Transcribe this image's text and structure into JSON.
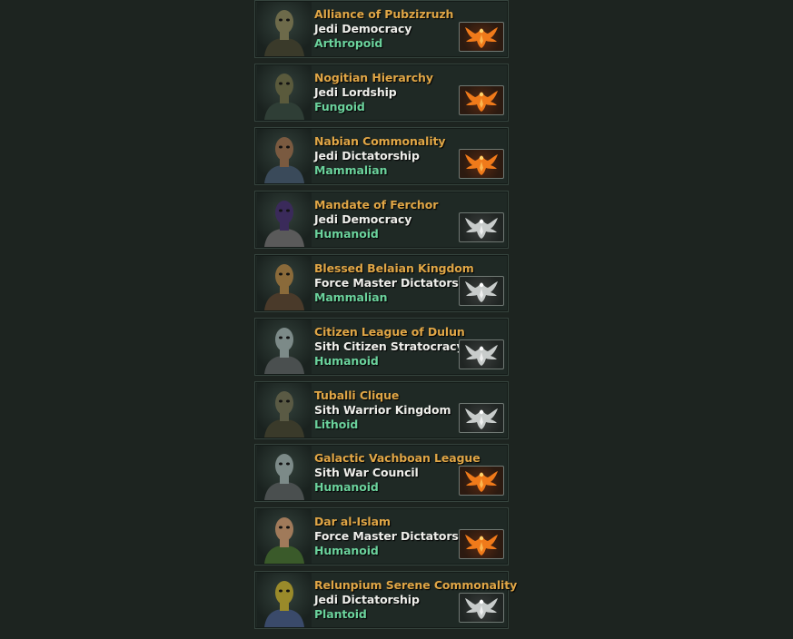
{
  "empires": [
    {
      "name": "Alliance of Pubzizruzh",
      "government": "Jedi Democracy",
      "species": "Arthropoid",
      "badge": "colored"
    },
    {
      "name": "Nogitian Hierarchy",
      "government": "Jedi Lordship",
      "species": "Fungoid",
      "badge": "colored"
    },
    {
      "name": "Nabian Commonality",
      "government": "Jedi Dictatorship",
      "species": "Mammalian",
      "badge": "colored"
    },
    {
      "name": "Mandate of Ferchor",
      "government": "Jedi Democracy",
      "species": "Humanoid",
      "badge": "gray"
    },
    {
      "name": "Blessed Belaian Kingdom",
      "government": "Force Master Dictatorship",
      "species": "Mammalian",
      "badge": "gray"
    },
    {
      "name": "Citizen League of Dulun",
      "government": "Sith Citizen Stratocracy",
      "species": "Humanoid",
      "badge": "gray"
    },
    {
      "name": "Tuballi Clique",
      "government": "Sith Warrior Kingdom",
      "species": "Lithoid",
      "badge": "gray"
    },
    {
      "name": "Galactic Vachboan League",
      "government": "Sith War Council",
      "species": "Humanoid",
      "badge": "colored"
    },
    {
      "name": "Dar al-Islam",
      "government": "Force Master Dictatorship",
      "species": "Humanoid",
      "badge": "colored"
    },
    {
      "name": "Relunpium Serene Commonality",
      "government": "Jedi Dictatorship",
      "species": "Plantoid",
      "badge": "gray"
    }
  ],
  "colors": {
    "background": "#1d2420",
    "name": "#e0a646",
    "government": "#eeeeea",
    "species": "#6bd29c",
    "badge_colored": "#f07a1a",
    "badge_gray": "#c8cccb"
  },
  "icons": {
    "portrait": "species-portrait",
    "badge": "phoenix-emblem-icon"
  }
}
